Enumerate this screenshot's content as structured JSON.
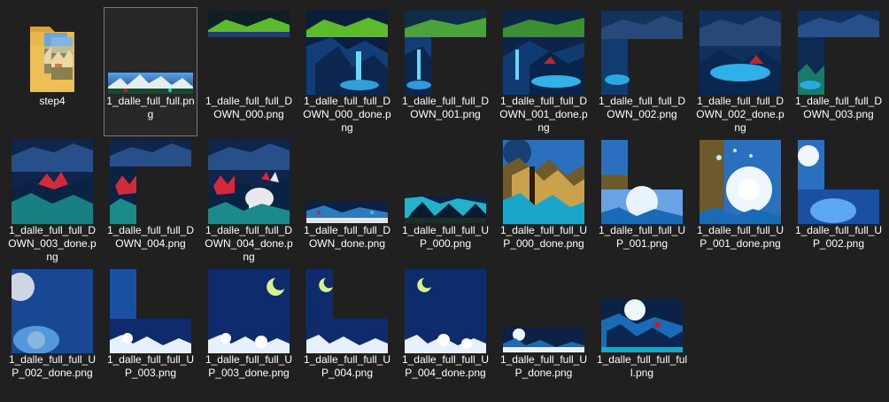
{
  "files": [
    {
      "name": "step4",
      "type": "folder"
    },
    {
      "name": "1_dalle_full_full.png",
      "type": "image",
      "thumb": "full-strip"
    },
    {
      "name": "1_dalle_full_full_DOWN_000.png",
      "type": "image",
      "thumb": "down-000"
    },
    {
      "name": "1_dalle_full_full_DOWN_000_done.png",
      "type": "image",
      "thumb": "down-000-done"
    },
    {
      "name": "1_dalle_full_full_DOWN_001.png",
      "type": "image",
      "thumb": "down-001"
    },
    {
      "name": "1_dalle_full_full_DOWN_001_done.png",
      "type": "image",
      "thumb": "down-001-done"
    },
    {
      "name": "1_dalle_full_full_DOWN_002.png",
      "type": "image",
      "thumb": "down-002"
    },
    {
      "name": "1_dalle_full_full_DOWN_002_done.png",
      "type": "image",
      "thumb": "down-002-done"
    },
    {
      "name": "1_dalle_full_full_DOWN_003.png",
      "type": "image",
      "thumb": "down-003"
    },
    {
      "name": "1_dalle_full_full_DOWN_003_done.png",
      "type": "image",
      "thumb": "down-003-done"
    },
    {
      "name": "1_dalle_full_full_DOWN_004.png",
      "type": "image",
      "thumb": "down-004"
    },
    {
      "name": "1_dalle_full_full_DOWN_004_done.png",
      "type": "image",
      "thumb": "down-004-done"
    },
    {
      "name": "1_dalle_full_full_DOWN_done.png",
      "type": "image",
      "thumb": "down-done-strip"
    },
    {
      "name": "1_dalle_full_full_UP_000.png",
      "type": "image",
      "thumb": "up-000"
    },
    {
      "name": "1_dalle_full_full_UP_000_done.png",
      "type": "image",
      "thumb": "up-000-done"
    },
    {
      "name": "1_dalle_full_full_UP_001.png",
      "type": "image",
      "thumb": "up-001"
    },
    {
      "name": "1_dalle_full_full_UP_001_done.png",
      "type": "image",
      "thumb": "up-001-done"
    },
    {
      "name": "1_dalle_full_full_UP_002.png",
      "type": "image",
      "thumb": "up-002"
    },
    {
      "name": "1_dalle_full_full_UP_002_done.png",
      "type": "image",
      "thumb": "up-002-done"
    },
    {
      "name": "1_dalle_full_full_UP_003.png",
      "type": "image",
      "thumb": "up-003"
    },
    {
      "name": "1_dalle_full_full_UP_003_done.png",
      "type": "image",
      "thumb": "up-003-done"
    },
    {
      "name": "1_dalle_full_full_UP_004.png",
      "type": "image",
      "thumb": "up-004"
    },
    {
      "name": "1_dalle_full_full_UP_004_done.png",
      "type": "image",
      "thumb": "up-004-done"
    },
    {
      "name": "1_dalle_full_full_UP_done.png",
      "type": "image",
      "thumb": "up-done-strip"
    },
    {
      "name": "1_dalle_full_full_full.png",
      "type": "image",
      "thumb": "full-full"
    }
  ],
  "selected_index": 1,
  "colors": {
    "background": "#202020",
    "text": "#ffffff",
    "folder": "#e8b84a"
  }
}
